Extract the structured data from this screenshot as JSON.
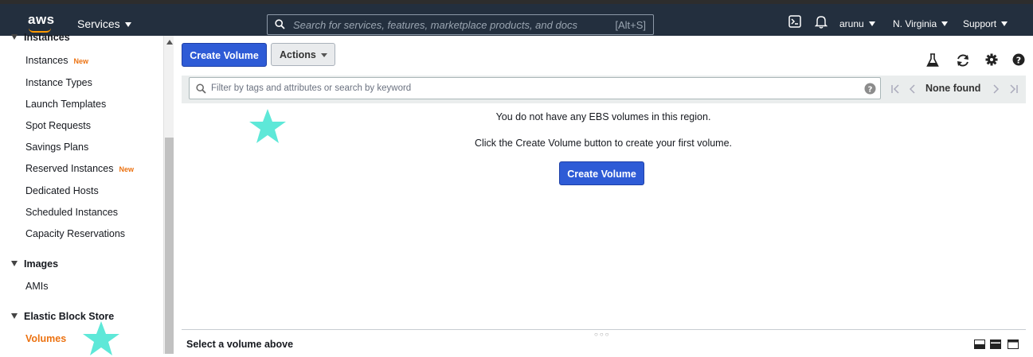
{
  "topbar": {
    "logo": "aws",
    "services": "Services",
    "search_placeholder": "Search for services, features, marketplace products, and docs",
    "search_shortcut": "[Alt+S]",
    "user": "arunu",
    "region": "N. Virginia",
    "support": "Support"
  },
  "sidebar": {
    "instances_header": "Instances",
    "items": [
      {
        "label": "Instances",
        "badge": "New"
      },
      {
        "label": "Instance Types"
      },
      {
        "label": "Launch Templates"
      },
      {
        "label": "Spot Requests"
      },
      {
        "label": "Savings Plans"
      },
      {
        "label": "Reserved Instances",
        "badge": "New"
      },
      {
        "label": "Dedicated Hosts"
      },
      {
        "label": "Scheduled Instances"
      },
      {
        "label": "Capacity Reservations"
      }
    ],
    "images_header": "Images",
    "images_items": [
      {
        "label": "AMIs"
      }
    ],
    "ebs_header": "Elastic Block Store",
    "ebs_items": [
      {
        "label": "Volumes",
        "active": true
      }
    ]
  },
  "toolbar": {
    "create_volume": "Create Volume",
    "actions": "Actions"
  },
  "filter": {
    "placeholder": "Filter by tags and attributes or search by keyword",
    "pager_status": "None found"
  },
  "empty_state": {
    "line1": "You do not have any EBS volumes in this region.",
    "line2": "Click the Create Volume button to create your first volume.",
    "button": "Create Volume"
  },
  "detail": {
    "placeholder": "Select a volume above"
  },
  "colors": {
    "topbar_bg": "#232f3e",
    "primary_button": "#2e5bd6",
    "accent_orange": "#ec7211",
    "star_annotation": "#5ee8d8"
  }
}
